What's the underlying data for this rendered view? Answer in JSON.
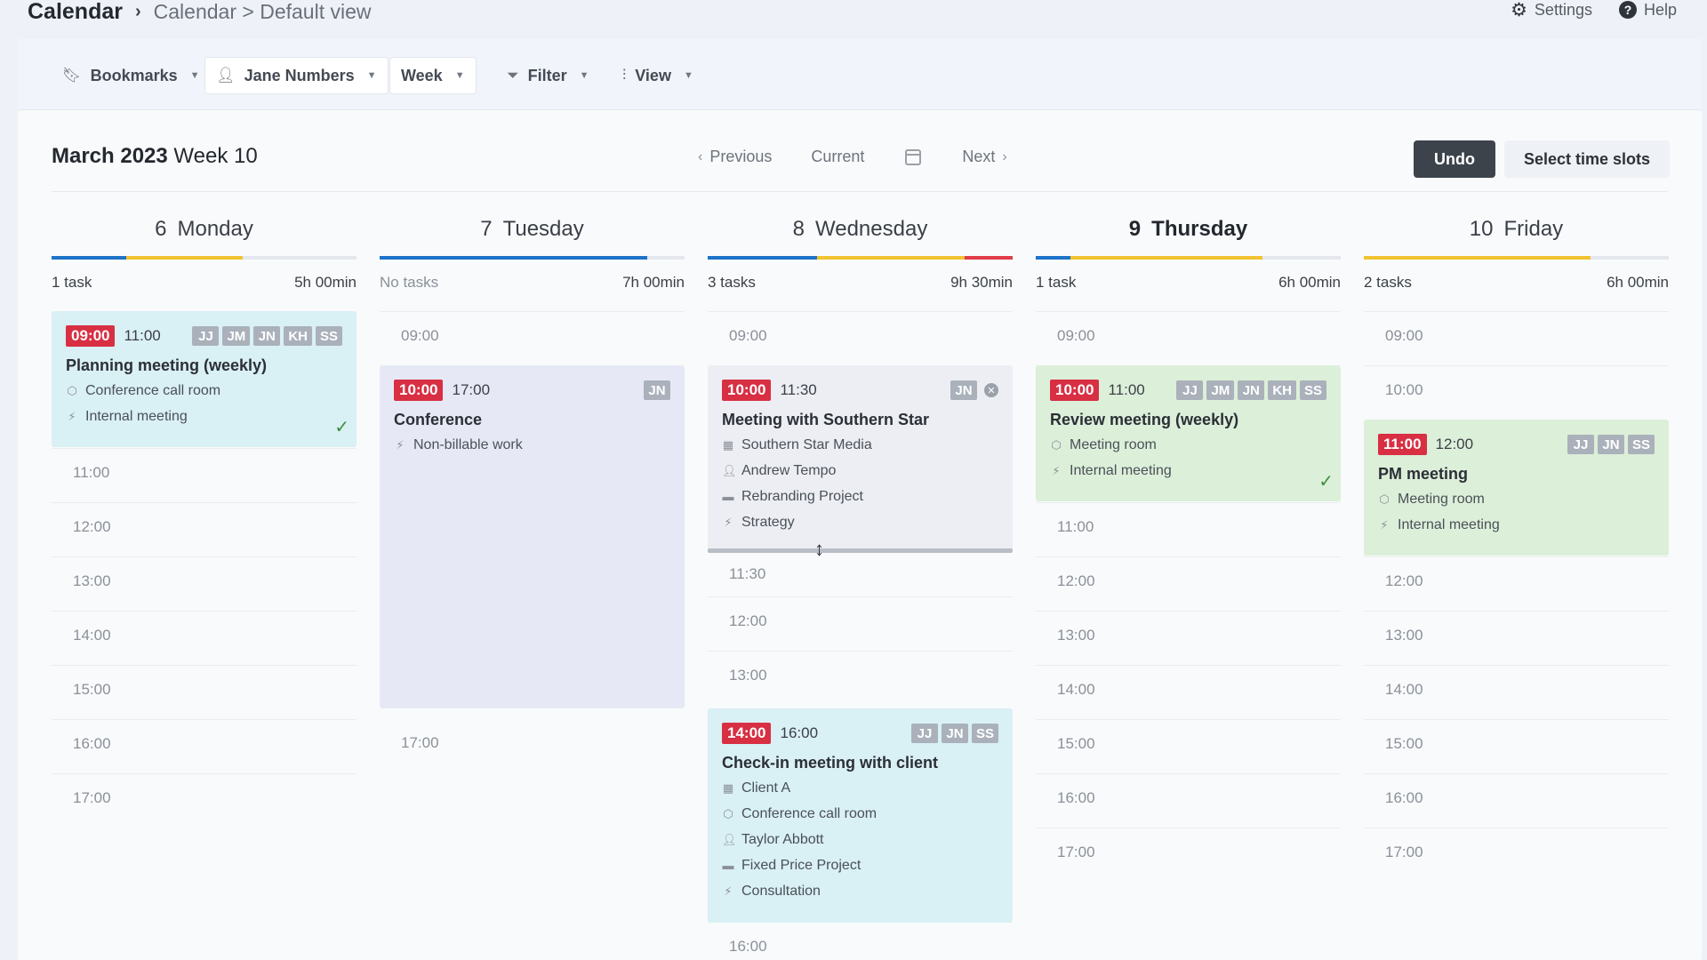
{
  "app": {
    "name": "Calendar",
    "breadcrumb": "Calendar > Default view",
    "settings_label": "Settings",
    "help_label": "Help"
  },
  "toolbar": {
    "bookmarks": "Bookmarks",
    "user": "Jane Numbers",
    "range": "Week",
    "filter": "Filter",
    "view": "View"
  },
  "header": {
    "month": "March 2023",
    "week": "Week 10",
    "previous": "Previous",
    "current": "Current",
    "next": "Next",
    "undo": "Undo",
    "select_slots": "Select time slots"
  },
  "colors": {
    "start_badge": "#d82f43",
    "cap_blue": "#1e73c8",
    "cap_yellow": "#f2c230",
    "cap_red": "#e03c4a",
    "teal_card": "#d9f0f4",
    "green_card": "#dcefd9",
    "lavender_card": "#e6e9f5"
  },
  "days": [
    {
      "num": "6",
      "name": "Monday",
      "tasks": "1 task",
      "hours": "5h 00min",
      "times": [
        "11:00",
        "12:00",
        "13:00",
        "14:00",
        "15:00",
        "16:00",
        "17:00"
      ],
      "events": [
        {
          "start": "09:00",
          "end": "11:00",
          "pills": [
            "JJ",
            "JM",
            "JN",
            "KH",
            "SS"
          ],
          "title": "Planning meeting (weekly)",
          "meta": [
            "Conference call room",
            "Internal meeting"
          ]
        }
      ]
    },
    {
      "num": "7",
      "name": "Tuesday",
      "tasks": "No tasks",
      "hours": "7h 00min",
      "times": [
        "09:00",
        "17:00"
      ],
      "events": [
        {
          "start": "10:00",
          "end": "17:00",
          "pills": [
            "JN"
          ],
          "title": "Conference",
          "meta": [
            "Non-billable work"
          ]
        }
      ]
    },
    {
      "num": "8",
      "name": "Wednesday",
      "tasks": "3 tasks",
      "hours": "9h 30min",
      "times": [
        "09:00",
        "11:30",
        "12:00",
        "13:00",
        "16:00"
      ],
      "events": [
        {
          "start": "10:00",
          "end": "11:30",
          "pills": [
            "JN"
          ],
          "title": "Meeting with Southern Star",
          "meta": [
            "Southern Star Media",
            "Andrew Tempo",
            "Rebranding Project",
            "Strategy"
          ]
        },
        {
          "start": "14:00",
          "end": "16:00",
          "pills": [
            "JJ",
            "JN",
            "SS"
          ],
          "title": "Check-in meeting with client",
          "meta": [
            "Client A",
            "Conference call room",
            "Taylor Abbott",
            "Fixed Price Project",
            "Consultation"
          ]
        }
      ]
    },
    {
      "num": "9",
      "name": "Thursday",
      "tasks": "1 task",
      "hours": "6h 00min",
      "times": [
        "09:00",
        "11:00",
        "12:00",
        "13:00",
        "14:00",
        "15:00",
        "16:00",
        "17:00"
      ],
      "events": [
        {
          "start": "10:00",
          "end": "11:00",
          "pills": [
            "JJ",
            "JM",
            "JN",
            "KH",
            "SS"
          ],
          "title": "Review meeting (weekly)",
          "meta": [
            "Meeting room",
            "Internal meeting"
          ]
        }
      ]
    },
    {
      "num": "10",
      "name": "Friday",
      "tasks": "2 tasks",
      "hours": "6h 00min",
      "times": [
        "09:00",
        "10:00",
        "12:00",
        "13:00",
        "14:00",
        "15:00",
        "16:00",
        "17:00"
      ],
      "events": [
        {
          "start": "11:00",
          "end": "12:00",
          "pills": [
            "JJ",
            "JN",
            "SS"
          ],
          "title": "PM meeting",
          "meta": [
            "Meeting room",
            "Internal meeting"
          ]
        }
      ]
    }
  ]
}
